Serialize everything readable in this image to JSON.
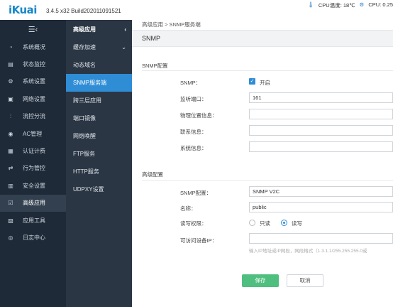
{
  "app": {
    "logo": "iKuai",
    "version": "3.4.5 x32 Build202011091521"
  },
  "status": {
    "cpu_temp": "CPU温度: 18℃",
    "cpu_usage": "CPU: 0.25"
  },
  "sidebar": {
    "items": [
      {
        "label": "系统概况",
        "icon": "dashboard-icon"
      },
      {
        "label": "状态监控",
        "icon": "monitor-icon"
      },
      {
        "label": "系统设置",
        "icon": "gear-icon"
      },
      {
        "label": "网络设置",
        "icon": "network-icon"
      },
      {
        "label": "流控分流",
        "icon": "sliders-icon"
      },
      {
        "label": "AC管理",
        "icon": "wifi-icon"
      },
      {
        "label": "认证计费",
        "icon": "id-card-icon"
      },
      {
        "label": "行为管控",
        "icon": "arrows-icon"
      },
      {
        "label": "安全设置",
        "icon": "firewall-icon"
      },
      {
        "label": "高级应用",
        "icon": "check-box-icon"
      },
      {
        "label": "应用工具",
        "icon": "tools-icon"
      },
      {
        "label": "日志中心",
        "icon": "log-icon"
      }
    ]
  },
  "submenu": {
    "title": "高级应用",
    "items": [
      {
        "label": "缓存加速"
      },
      {
        "label": "动态域名"
      },
      {
        "label": "SNMP服务端"
      },
      {
        "label": "跨三层应用"
      },
      {
        "label": "端口镜像"
      },
      {
        "label": "网络唤醒"
      },
      {
        "label": "FTP服务"
      },
      {
        "label": "HTTP服务"
      },
      {
        "label": "UDPXY设置"
      }
    ]
  },
  "breadcrumb": "高级应用 > SNMP服务端",
  "page_title": "SNMP",
  "snmp_config": {
    "section_title": "SNMP配置",
    "snmp_label": "SNMP：",
    "snmp_enabled_label": "开启",
    "port_label": "监听端口：",
    "port_value": "161",
    "location_label": "物理位置信息：",
    "location_value": "",
    "contact_label": "联系信息：",
    "contact_value": "",
    "system_label": "系统信息：",
    "system_value": ""
  },
  "advanced_config": {
    "section_title": "高级配置",
    "snmp_version_label": "SNMP配置：",
    "snmp_version_value": "SNMP V2C",
    "name_label": "名称：",
    "name_value": "public",
    "permission_label": "读写权限：",
    "permission_readonly": "只读",
    "permission_readwrite": "读写",
    "allowed_ip_label": "可访问设备IP：",
    "allowed_ip_value": "",
    "allowed_ip_hint": "输入IP地址或IP网段，网段格式（1.3.1.1/255.255.255.0或"
  },
  "actions": {
    "save": "保存",
    "cancel": "取消"
  },
  "colors": {
    "sidebar_bg": "#1e2a38",
    "submenu_bg": "#2b3644",
    "accent": "#2f8dd6",
    "save": "#4fbf7f"
  }
}
